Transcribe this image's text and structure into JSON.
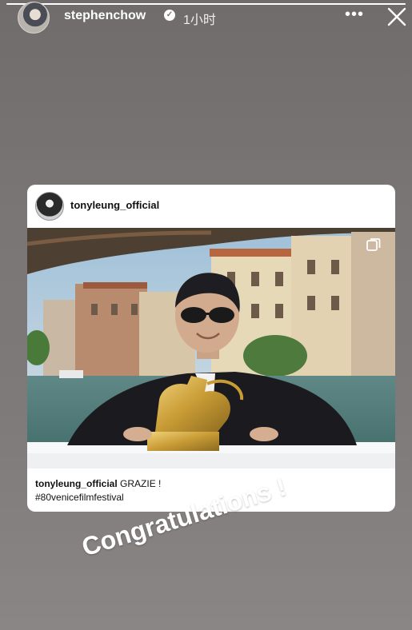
{
  "header": {
    "username": "stephenchow",
    "verified_icon": "verified-badge-icon",
    "time_ago": "1小时",
    "more_icon": "more-dots-icon",
    "more_glyph": "•••",
    "close_icon": "close-icon"
  },
  "story_progress": 1.0,
  "shared_post": {
    "username": "tonyleung_official",
    "caption_user": "tonyleung_official",
    "caption_text": "GRAZIE !",
    "hashtag": "#80venicefilmfestival",
    "carousel_icon": "multiple-photos-icon"
  },
  "sticker_text": "Congratulations !",
  "colors": {
    "story_bg": "#7a7675",
    "card_bg": "#ffffff",
    "text_primary": "#111111",
    "header_text": "#ffffff"
  }
}
